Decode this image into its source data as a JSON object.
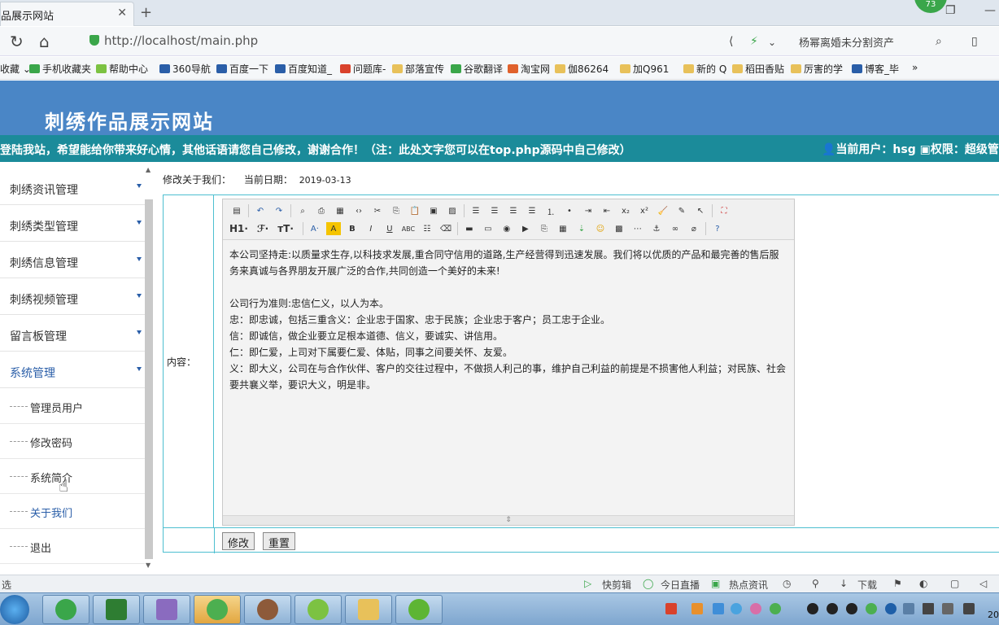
{
  "browser": {
    "tab_title": "品展示网站",
    "tab_close": "✕",
    "new_tab": "+",
    "notification_count": "73",
    "url": "http://localhost/main.php",
    "search_text": "杨幂离婚未分割资产",
    "bookmarks": [
      {
        "label": "收藏 ⌄",
        "icon": "star"
      },
      {
        "label": "手机收藏夹",
        "icon": "phone"
      },
      {
        "label": "帮助中心",
        "icon": "help"
      },
      {
        "label": "360导航",
        "icon": "paw"
      },
      {
        "label": "百度一下",
        "icon": "paw"
      },
      {
        "label": "百度知道_",
        "icon": "paw"
      },
      {
        "label": "问题库-",
        "icon": "s"
      },
      {
        "label": "部落宣传",
        "icon": "folder"
      },
      {
        "label": "谷歌翻译",
        "icon": "green"
      },
      {
        "label": "淘宝网",
        "icon": "taobao"
      },
      {
        "label": "伽86264",
        "icon": "folder"
      },
      {
        "label": "加Q961",
        "icon": "folder"
      },
      {
        "label": "新的 Q",
        "icon": "folder"
      },
      {
        "label": "稻田香贴",
        "icon": "folder"
      },
      {
        "label": "厉害的学",
        "icon": "folder"
      },
      {
        "label": "博客_毕",
        "icon": "paw"
      },
      {
        "label": "»",
        "icon": "none"
      }
    ]
  },
  "site": {
    "title": "刺绣作品展示网站",
    "marquee": "登陆我站，希望能给你带来好心情，其他话语请您自己修改，谢谢合作！（注：此处文字您可以在top.php源码中自己修改）",
    "user_info": "当前用户：hsg",
    "role_info": "权限：超级管理"
  },
  "sidebar": {
    "menu": [
      {
        "label": "刺绣资讯管理"
      },
      {
        "label": "刺绣类型管理"
      },
      {
        "label": "刺绣信息管理"
      },
      {
        "label": "刺绣视频管理"
      },
      {
        "label": "留言板管理"
      },
      {
        "label": "系统管理"
      }
    ],
    "submenu": [
      {
        "label": "管理员用户"
      },
      {
        "label": "修改密码"
      },
      {
        "label": "系统简介"
      },
      {
        "label": "关于我们"
      },
      {
        "label": "退出"
      }
    ]
  },
  "main": {
    "breadcrumb": "修改关于我们：",
    "date_label": "当前日期：",
    "date_value": "2019-03-13",
    "field_label": "内容：",
    "editor": {
      "heading_btn": "H1·",
      "font_btn": "ℱ·",
      "size_btn": "тT·",
      "paragraphs": [
        "本公司坚持走:以质量求生存,以科技求发展,重合同守信用的道路,生产经营得到迅速发展。我们将以优质的产品和最完善的售后服务来真诚与各界朋友开展广泛的合作,共同创造一个美好的未来!",
        "",
        "公司行为准则:忠信仁义，以人为本。",
        "忠：即忠诚，包括三重含义：企业忠于国家、忠于民族；企业忠于客户；员工忠于企业。",
        "信：即诚信，做企业要立足根本道德、信义，要诚实、讲信用。",
        "仁：即仁爱，上司对下属要仁爱、体贴，同事之间要关怀、友爱。",
        "义：即大义，公司在与合作伙伴、客户的交往过程中，不做损人利己的事，维护自己利益的前提是不损害他人利益；对民族、社会要共襄义举，要识大义，明是非。"
      ]
    },
    "submit_label": "修改",
    "reset_label": "重置"
  },
  "statusbar": {
    "left": "选",
    "items": [
      "快剪辑",
      "今日直播",
      "热点资讯",
      "下载"
    ]
  },
  "taskbar": {
    "clock": "20"
  },
  "colors": {
    "header_blue": "#4a86c6",
    "marquee_teal": "#1b8b9a",
    "table_border": "#4dbfd0",
    "active_blue": "#2a5ea8"
  }
}
